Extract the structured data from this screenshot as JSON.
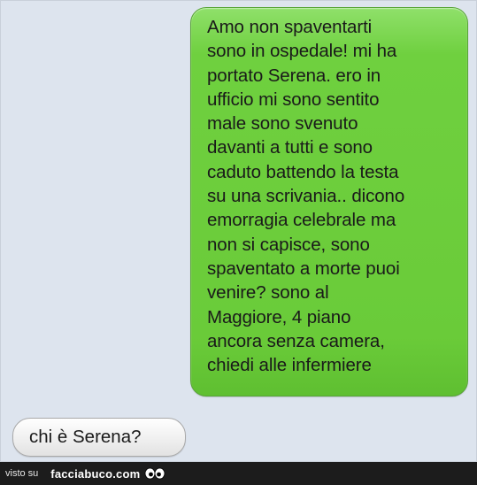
{
  "conversation": {
    "sent_message": "Amo non spaventarti\nsono in ospedale! mi ha\nportato Serena. ero in\nufficio mi sono sentito\nmale sono svenuto\ndavanti a tutti e sono\ncaduto battendo la testa\nsu una scrivania.. dicono\nemorragia celebrale ma\nnon si capisce, sono\nspaventato a morte puoi\nvenire? sono al\nMaggiore, 4 piano\nancora senza camera,\nchiedi alle infermiere",
    "received_message": "chi è Serena?"
  },
  "footer": {
    "prefix": "visto su",
    "brand": "facciabuco.com",
    "logo_icon": "eyes-icon"
  },
  "colors": {
    "sent_bubble": "#6acb39",
    "received_bubble": "#eeeeee",
    "background": "#dde4ee",
    "footer_bar": "#1c1c1c"
  }
}
